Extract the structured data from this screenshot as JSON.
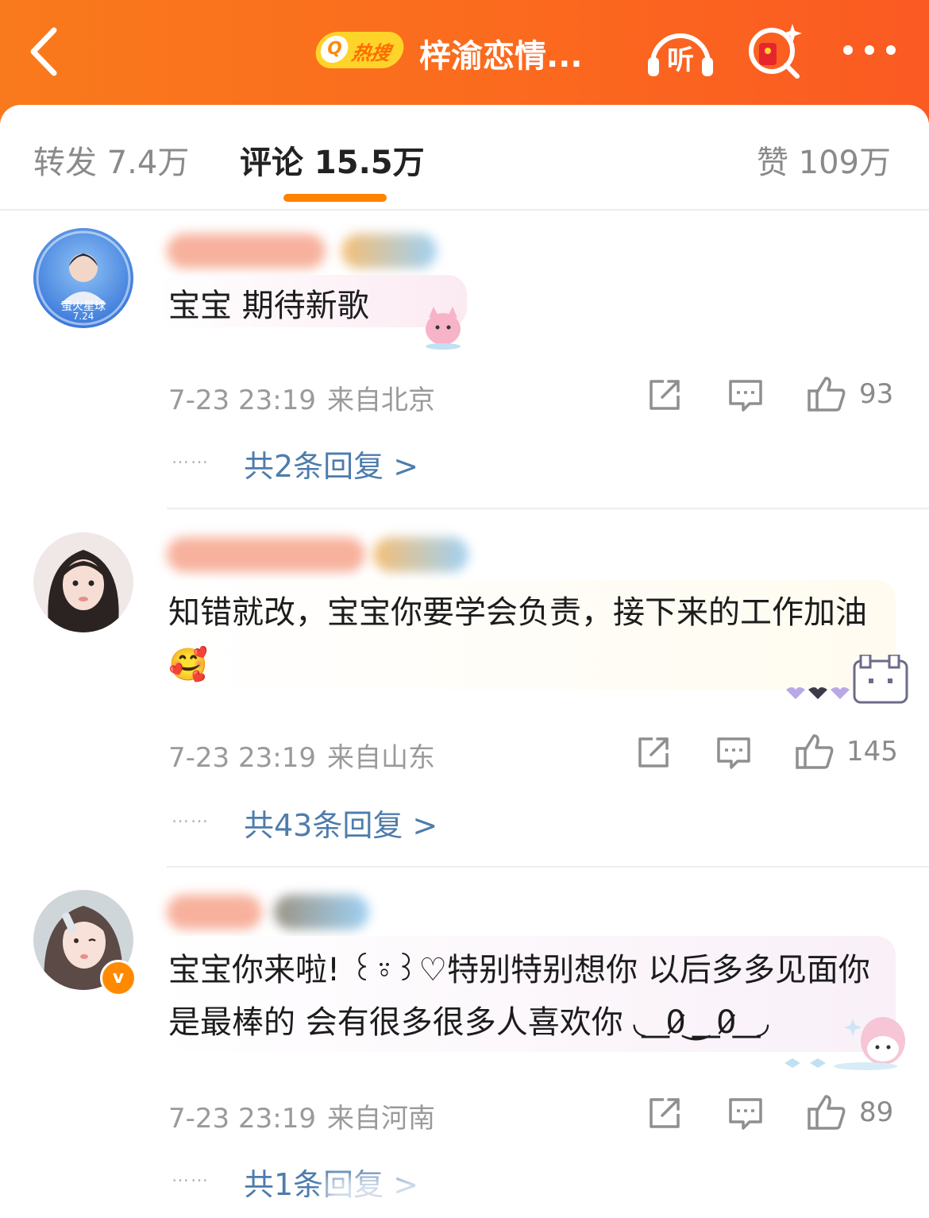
{
  "header": {
    "hot_badge": "热搜",
    "title": "梓渝恋情...",
    "listen_label": "听",
    "colors": {
      "header_bg": "#fb6a1e",
      "hot_badge": "#ffd42a",
      "accent": "#ff8200",
      "link": "#4e7cac"
    }
  },
  "tabs": {
    "repost": "转发 7.4万",
    "comment": "评论 15.5万",
    "like": "赞 109万"
  },
  "comments": [
    {
      "avatar_text": "萤火星球",
      "avatar_date": "7.24",
      "text": "宝宝 期待新歌",
      "time": "7-23 23:19",
      "location": "来自北京",
      "likes": "93",
      "replies": "共2条回复 >"
    },
    {
      "text": "知错就改，宝宝你要学会负责，接下来的工作加油🥰",
      "time": "7-23 23:19",
      "location": "来自山东",
      "likes": "145",
      "replies": "共43条回复 >"
    },
    {
      "verified_label": "v",
      "text": "宝宝你来啦! ꒰⍤꒱♡特别特别想你 以后多多见面你是最棒的 会有很多很多人喜欢你 ◟ ͟ 0̷ ͜ ͟ 0̷ ͟ ◞",
      "time": "7-23 23:19",
      "location": "来自河南",
      "likes": "89",
      "replies": "共1条回复 >"
    }
  ],
  "ellipsis": "……"
}
